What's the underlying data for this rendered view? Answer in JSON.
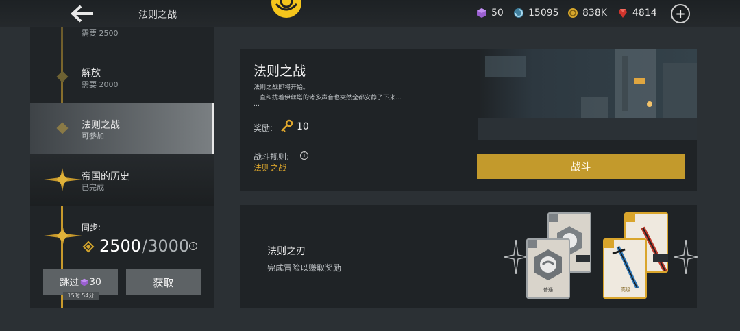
{
  "header": {
    "title": "法则之战",
    "resources": [
      {
        "icon": "purple-cube-icon",
        "value": "50",
        "color": "#a46ed6"
      },
      {
        "icon": "blue-swirl-icon",
        "value": "15095",
        "color": "#5aa7c9"
      },
      {
        "icon": "gold-coin-icon",
        "value": "838K",
        "color": "#d4a52c"
      },
      {
        "icon": "red-gem-icon",
        "value": "4814",
        "color": "#d0342c"
      }
    ]
  },
  "stages": [
    {
      "name": "",
      "sub": "需要 2500"
    },
    {
      "name": "解放",
      "sub": "需要 2000"
    },
    {
      "name": "法则之战",
      "sub": "可参加"
    },
    {
      "name": "帝国的历史",
      "sub": "已完成"
    }
  ],
  "sync": {
    "label": "同步:",
    "current": "2500",
    "max": "/3000",
    "info": "i"
  },
  "skip": {
    "label": "跳过",
    "cost": "30",
    "timer": "15时 54分"
  },
  "claim_label": "获取",
  "battle": {
    "title": "法则之战",
    "desc_line1": "法则之战即将开始。",
    "desc_line2": "一直纠扰着伊丝塔的诸多声音也突然全都安静了下来…",
    "desc_line3": "…",
    "reward_label": "奖励:",
    "reward_value": "10",
    "rules_label": "战斗规则:",
    "rules_value": "法则之战",
    "fight_label": "战斗"
  },
  "blade": {
    "title": "法则之刃",
    "subtitle": "完成冒险以赚取奖励",
    "cards": [
      {
        "tag": "普通"
      },
      {
        "tag": "高级"
      }
    ]
  },
  "colors": {
    "accent_gold": "#c39a2c",
    "panel_bg": "#1f2326",
    "page_bg": "#2b3034"
  }
}
